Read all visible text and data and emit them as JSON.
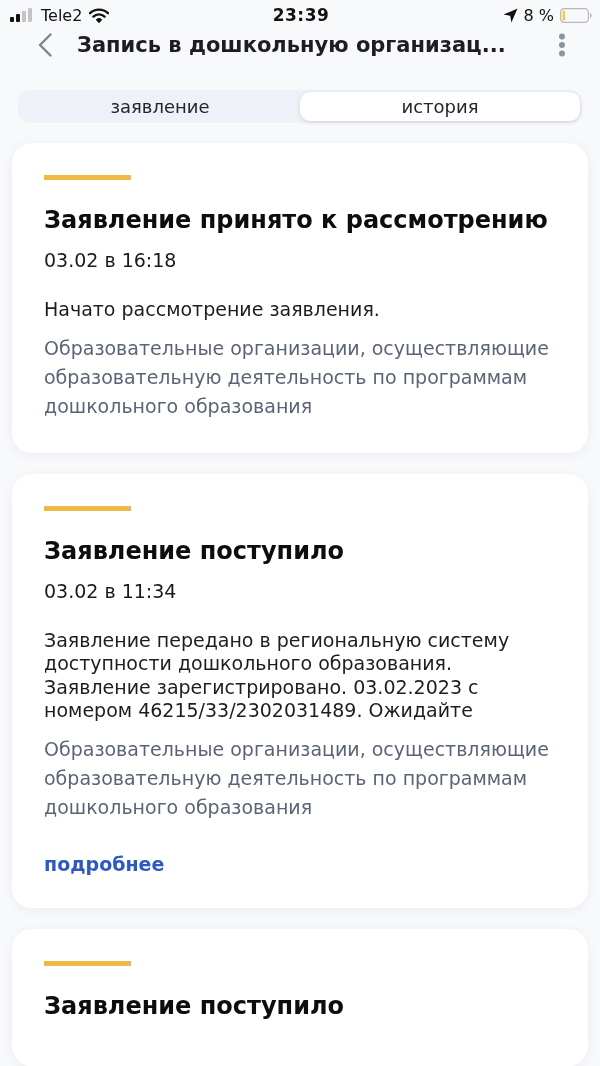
{
  "status_bar": {
    "carrier": "Tele2",
    "time": "23:39",
    "battery": "8 %"
  },
  "header": {
    "title": "Запись в дошкольную организац..."
  },
  "tabs": [
    {
      "label": "заявление",
      "selected": false
    },
    {
      "label": "история",
      "selected": true
    }
  ],
  "events": [
    {
      "title": "Заявление принято к рассмотрению",
      "date": "03.02 в 16:18",
      "message": "Начато рассмотрение заявления.",
      "organization": "Образовательные организации, осуществляющие образовательную деятельность по программам дошкольного образования"
    },
    {
      "title": "Заявление поступило",
      "date": "03.02 в 11:34",
      "message": "Заявление передано в региональную систему доступности дошкольного образования. Заявление зарегистрировано. 03.02.2023 с номером 46215/33/2302031489. Ожидайте",
      "organization": "Образовательные организации, осуществляющие образовательную деятельность по программам дошкольного образования",
      "link": "подробнее"
    },
    {
      "title": "Заявление поступило"
    }
  ]
}
